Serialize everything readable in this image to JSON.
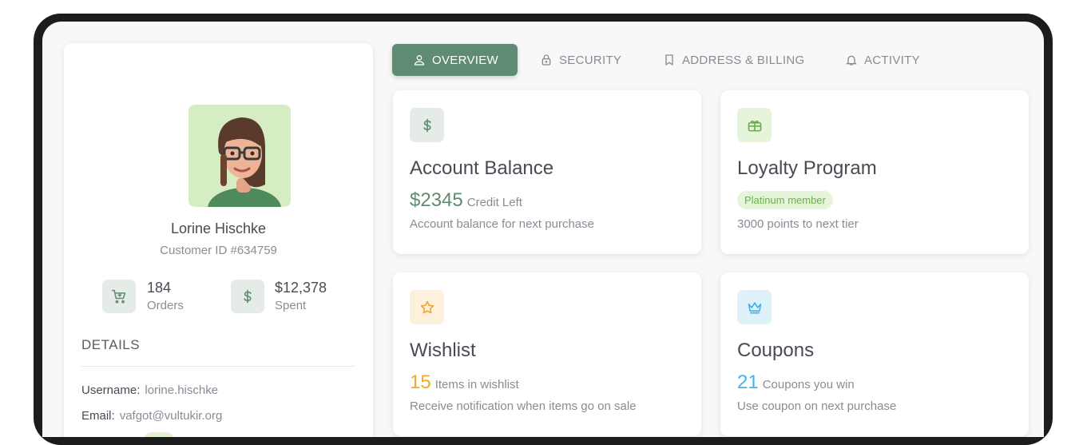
{
  "profile": {
    "name": "Lorine Hischke",
    "customer_id": "Customer ID #634759",
    "orders_value": "184",
    "orders_label": "Orders",
    "spent_value": "$12,378",
    "spent_label": "Spent",
    "details_title": "DETAILS",
    "username_label": "Username:",
    "username_value": "lorine.hischke",
    "email_label": "Email:",
    "email_value": "vafgot@vultukir.org"
  },
  "tabs": [
    {
      "label": "OVERVIEW",
      "icon": "user-icon",
      "active": true
    },
    {
      "label": "SECURITY",
      "icon": "lock-icon",
      "active": false
    },
    {
      "label": "ADDRESS & BILLING",
      "icon": "bookmark-icon",
      "active": false
    },
    {
      "label": "ACTIVITY",
      "icon": "bell-icon",
      "active": false
    }
  ],
  "cards": {
    "balance": {
      "title": "Account Balance",
      "amount": "$2345",
      "amount_suffix": "Credit Left",
      "desc": "Account balance for next purchase",
      "icon": "dollar-icon"
    },
    "loyalty": {
      "title": "Loyalty Program",
      "badge": "Platinum member",
      "desc": "3000 points to next tier",
      "icon": "gift-icon"
    },
    "wishlist": {
      "title": "Wishlist",
      "count": "15",
      "count_suffix": "Items in wishlist",
      "desc": "Receive notification when items go on sale",
      "icon": "star-icon"
    },
    "coupons": {
      "title": "Coupons",
      "count": "21",
      "count_suffix": "Coupons you win",
      "desc": "Use coupon on next purchase",
      "icon": "crown-icon"
    }
  },
  "colors": {
    "accent": "#5f8b73",
    "green": "#6ab04c",
    "orange": "#f0a830",
    "blue": "#3fb5e8"
  }
}
